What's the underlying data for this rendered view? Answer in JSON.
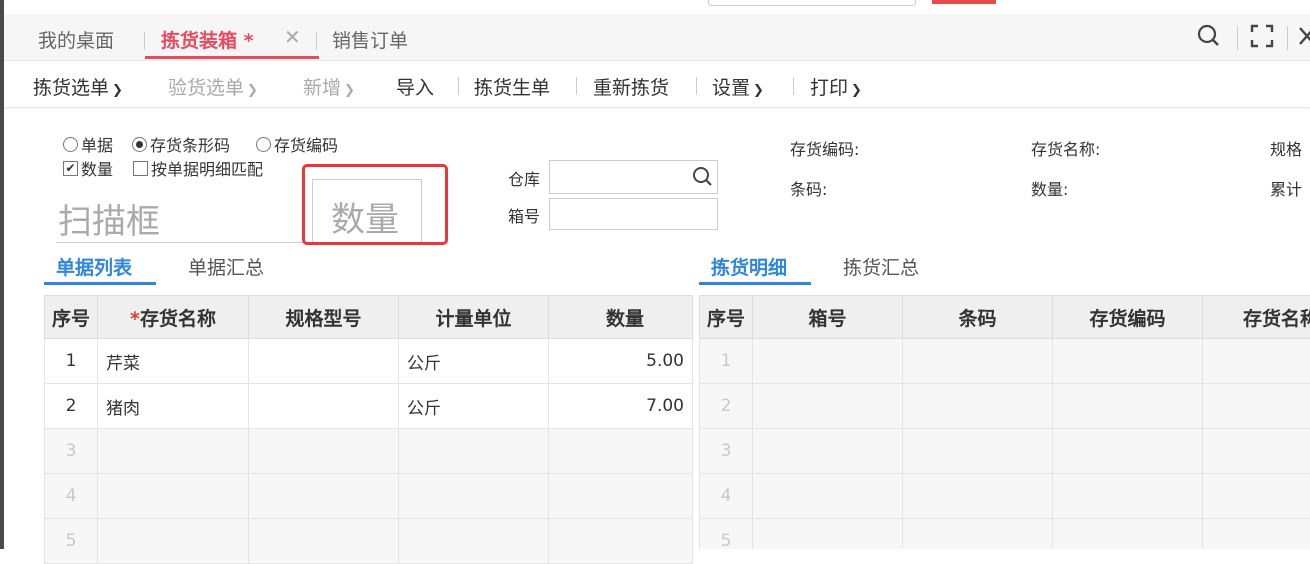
{
  "tabs": [
    {
      "label": "我的桌面"
    },
    {
      "label": "拣货装箱 *"
    },
    {
      "label": "销售订单"
    }
  ],
  "toolbar": {
    "items": [
      {
        "label": "拣货选单"
      },
      {
        "label": "验货选单"
      },
      {
        "label": "新增"
      },
      {
        "label": "导入"
      },
      {
        "label": "拣货生单"
      },
      {
        "label": "重新拣货"
      },
      {
        "label": "设置"
      },
      {
        "label": "打印"
      }
    ]
  },
  "scan": {
    "radios": [
      "单据",
      "存货条形码",
      "存货编码"
    ],
    "selected_radio": "存货条形码",
    "checkboxes": [
      {
        "label": "数量",
        "checked": true
      },
      {
        "label": "按单据明细匹配",
        "checked": false
      }
    ],
    "scan_placeholder": "扫描框",
    "qty_placeholder": "数量",
    "warehouse_label": "仓库",
    "box_label": "箱号"
  },
  "info": {
    "code_label": "存货编码:",
    "name_label": "存货名称:",
    "spec_label": "规格",
    "barcode_label": "条码:",
    "qty_label": "数量:",
    "cum_label": "累计"
  },
  "left_panel": {
    "tabs": [
      "单据列表",
      "单据汇总"
    ],
    "required_mark": "*",
    "columns": [
      "序号",
      "存货名称",
      "规格型号",
      "计量单位",
      "数量"
    ],
    "rows": [
      {
        "no": "1",
        "name": "芹菜",
        "spec": "",
        "unit": "公斤",
        "qty": "5.00"
      },
      {
        "no": "2",
        "name": "猪肉",
        "spec": "",
        "unit": "公斤",
        "qty": "7.00"
      },
      {
        "no": "3",
        "name": "",
        "spec": "",
        "unit": "",
        "qty": ""
      },
      {
        "no": "4",
        "name": "",
        "spec": "",
        "unit": "",
        "qty": ""
      },
      {
        "no": "5",
        "name": "",
        "spec": "",
        "unit": "",
        "qty": ""
      }
    ]
  },
  "right_panel": {
    "tabs": [
      "拣货明细",
      "拣货汇总"
    ],
    "columns": [
      "序号",
      "箱号",
      "条码",
      "存货编码",
      "存货名称"
    ],
    "rows": [
      {
        "no": "1"
      },
      {
        "no": "2"
      },
      {
        "no": "3"
      },
      {
        "no": "4"
      },
      {
        "no": "5"
      }
    ]
  },
  "colors": {
    "active_tab": "#e84a5f",
    "sub_tab_active": "#2e86de",
    "highlight_box": "#e53935"
  }
}
